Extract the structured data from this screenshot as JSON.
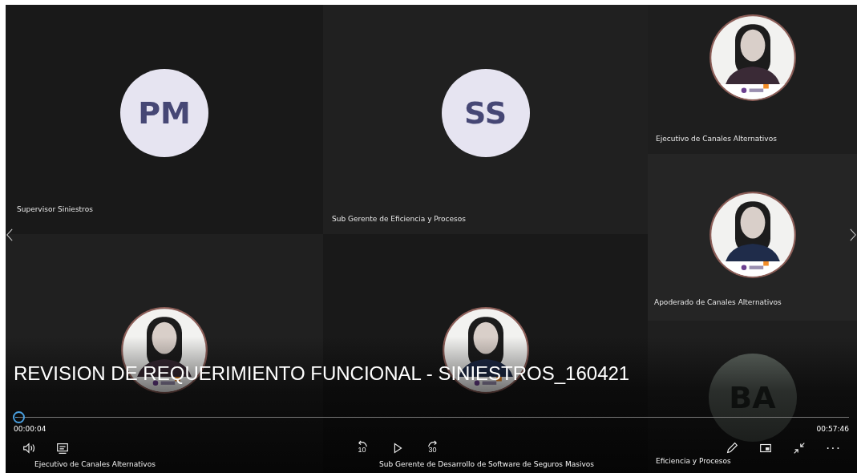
{
  "tiles": [
    {
      "kind": "initials",
      "initials": "PM",
      "label": "Supervisor Siniestros"
    },
    {
      "kind": "initials",
      "initials": "SS",
      "label": "Sub Gerente de Eficiencia y Procesos"
    },
    {
      "label": "Ejecutivo de Canales Alternativos"
    },
    {
      "label": "Sub Gerente de Desarrollo de Software de Seguros Masivos"
    }
  ],
  "side_tiles": [
    {
      "label": "Ejecutivo de Canales Alternativos"
    },
    {
      "label": "Apoderado de Canales Alternativos"
    },
    {
      "kind": "initials",
      "initials": "BA",
      "label": "Eficiencia y Procesos"
    }
  ],
  "player": {
    "title": "REVISION DE REQUERIMIENTO FUNCIONAL - SINIESTROS_160421",
    "level": 0.003,
    "elapsed": "00:00:04",
    "duration": "00:57:46",
    "rewind_label": "10",
    "forward_label": "30",
    "more_label": "···"
  }
}
